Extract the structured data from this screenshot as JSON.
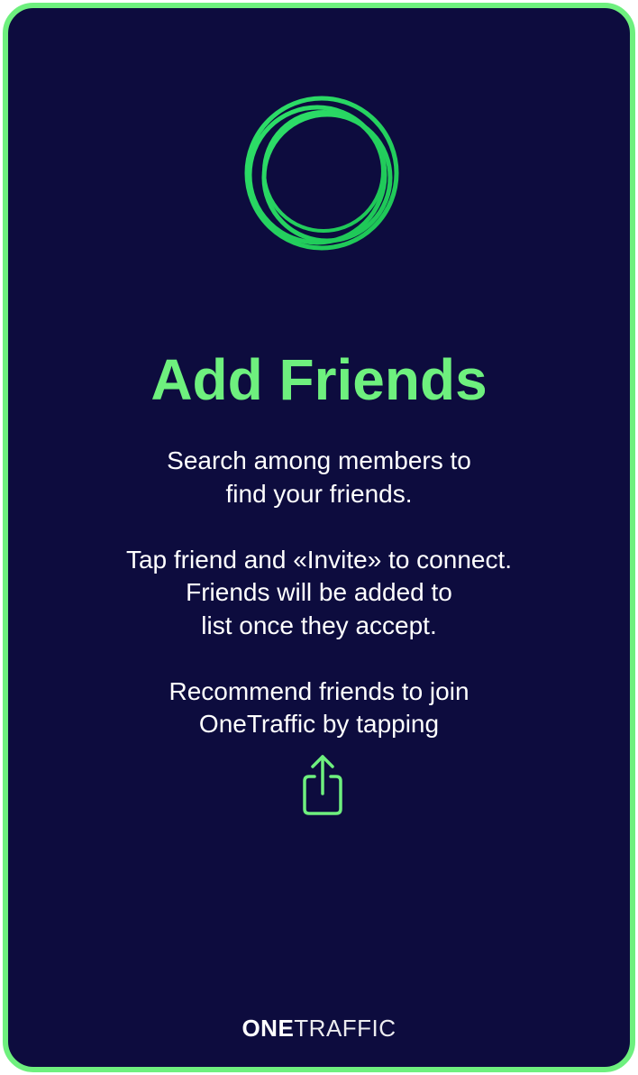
{
  "card": {
    "title": "Add Friends",
    "paragraphs": [
      [
        "Search among members to",
        "find your friends."
      ],
      [
        "Tap friend and «Invite» to connect.",
        "Friends will be added to",
        "list once they accept."
      ],
      [
        "Recommend friends to join",
        "OneTraffic by tapping"
      ]
    ]
  },
  "icons": {
    "logo": "rings-logo-icon",
    "share": "share-icon"
  },
  "brand": {
    "one": "ONE",
    "traffic": "TRAFFIC"
  },
  "colors": {
    "accent": "#6ef07e",
    "background": "#0d0c3e",
    "text": "#ffffff"
  }
}
